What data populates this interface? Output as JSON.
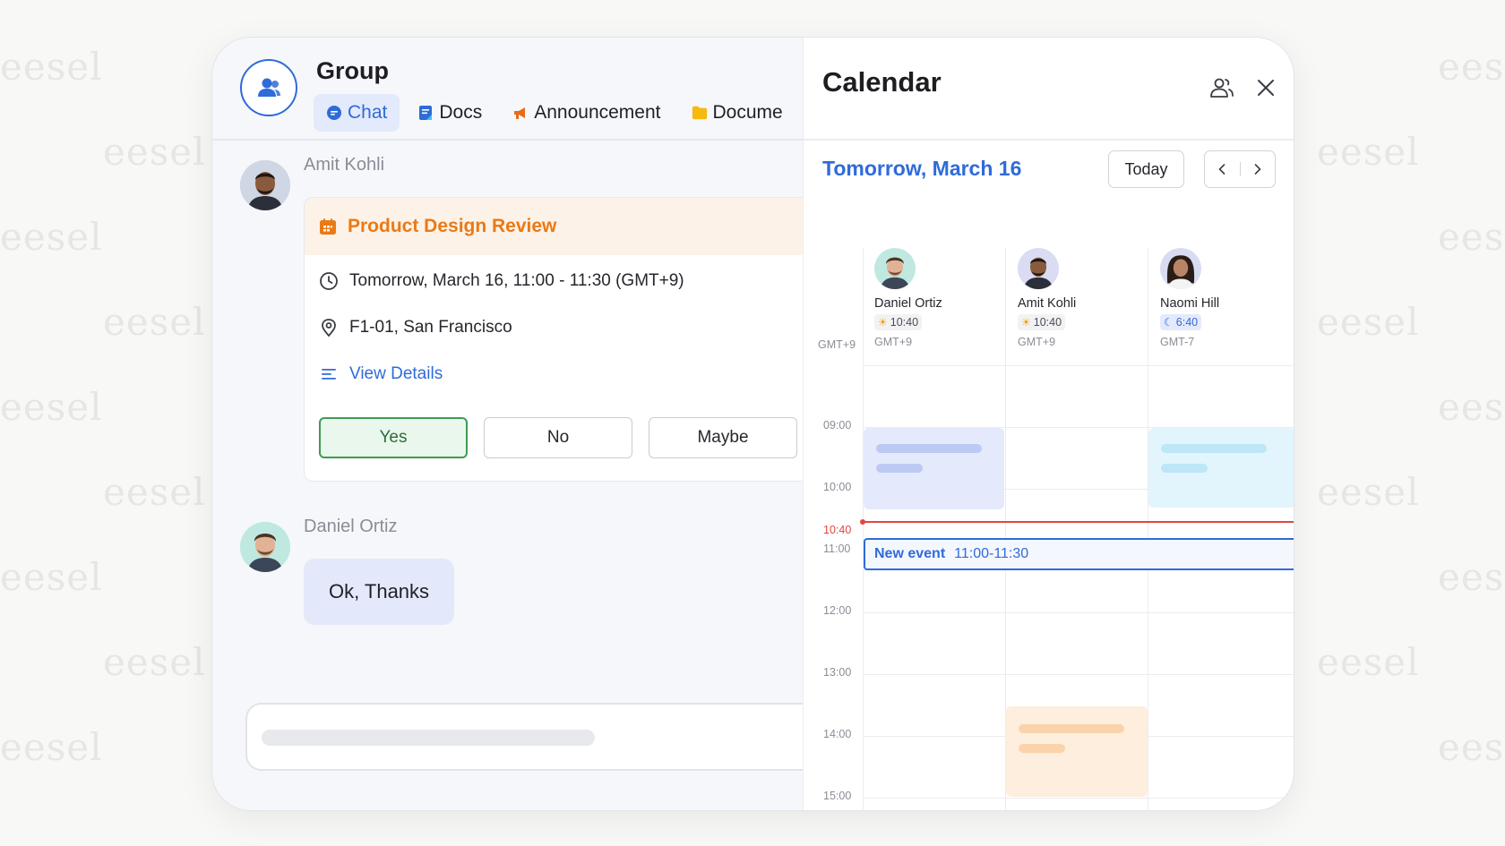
{
  "watermark": "eesel",
  "group": {
    "title": "Group",
    "tabs": [
      {
        "label": "Chat",
        "icon": "chat-bubble-icon",
        "active": true
      },
      {
        "label": "Docs",
        "icon": "doc-icon"
      },
      {
        "label": "Announcement",
        "icon": "megaphone-icon"
      },
      {
        "label": "Docume",
        "icon": "folder-icon"
      }
    ]
  },
  "messages": [
    {
      "sender": "Amit Kohli",
      "event": {
        "title": "Product Design Review",
        "time": "Tomorrow, March 16, 11:00 - 11:30 (GMT+9)",
        "location": "F1-01, San Francisco",
        "details_link": "View Details",
        "rsvp": {
          "yes": "Yes",
          "no": "No",
          "maybe": "Maybe",
          "selected": "yes"
        }
      }
    },
    {
      "sender": "Daniel Ortiz",
      "text": "Ok, Thanks"
    }
  ],
  "calendar": {
    "title": "Calendar",
    "date_label": "Tomorrow, March 16",
    "today_label": "Today",
    "timezone_label": "GMT+9",
    "people": [
      {
        "name": "Daniel Ortiz",
        "local_time": "10:40",
        "time_icon": "sun-icon",
        "tz": "GMT+9"
      },
      {
        "name": "Amit Kohli",
        "local_time": "10:40",
        "time_icon": "sun-icon",
        "tz": "GMT+9"
      },
      {
        "name": "Naomi Hill",
        "local_time": "6:40",
        "time_icon": "moon-icon",
        "tz": "GMT-7"
      }
    ],
    "hours": [
      "09:00",
      "10:00",
      "11:00",
      "12:00",
      "13:00",
      "14:00",
      "15:00"
    ],
    "now_label": "10:40",
    "new_event": {
      "title": "New event",
      "time": "11:00-11:30"
    },
    "colors": {
      "accent": "#2f6bd9",
      "now_line": "#e4453f",
      "busy_blue": "#e4e9fb",
      "busy_cyan": "#e2f5fc",
      "busy_orange": "#fdeedd",
      "event_header": "#fdf2e7",
      "event_title": "#ea7a16",
      "rsvp_yes": "#3f9b52"
    }
  }
}
